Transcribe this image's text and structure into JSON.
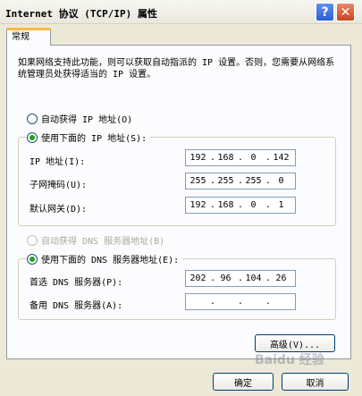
{
  "window": {
    "title": "Internet 协议 (TCP/IP) 属性",
    "help_glyph": "?",
    "close_glyph": "✕"
  },
  "tabs": [
    {
      "label": "常规"
    }
  ],
  "description": "如果网络支持此功能，则可以获取自动指派的 IP 设置。否则，您需要从网络系统管理员处获得适当的 IP 设置。",
  "ip_mode": {
    "auto_label": "自动获得 IP 地址(O)",
    "manual_label": "使用下面的 IP 地址(S):",
    "selected": "manual"
  },
  "ip_fields": [
    {
      "label": "IP 地址(I):",
      "octets": [
        "192",
        "168",
        "0",
        "142"
      ]
    },
    {
      "label": "子网掩码(U):",
      "octets": [
        "255",
        "255",
        "255",
        "0"
      ]
    },
    {
      "label": "默认网关(D):",
      "octets": [
        "192",
        "168",
        "0",
        "1"
      ]
    }
  ],
  "dns_mode": {
    "auto_label": "自动获得 DNS 服务器地址(B)",
    "manual_label": "使用下面的 DNS 服务器地址(E):",
    "selected": "manual"
  },
  "dns_fields": [
    {
      "label": "首选 DNS 服务器(P):",
      "octets": [
        "202",
        "96",
        "104",
        "26"
      ]
    },
    {
      "label": "备用 DNS 服务器(A):",
      "octets": [
        "",
        "",
        "",
        ""
      ]
    }
  ],
  "buttons": {
    "advanced": "高级(V)...",
    "ok": "确定",
    "cancel": "取消"
  },
  "watermark": "Baidu 经验",
  "colors": {
    "window_bg": "#ece9d8",
    "panel_bg": "#fcfcfe",
    "tab_accent": "#f9b843",
    "radio_check": "#21a121",
    "input_border": "#7f9db9"
  }
}
